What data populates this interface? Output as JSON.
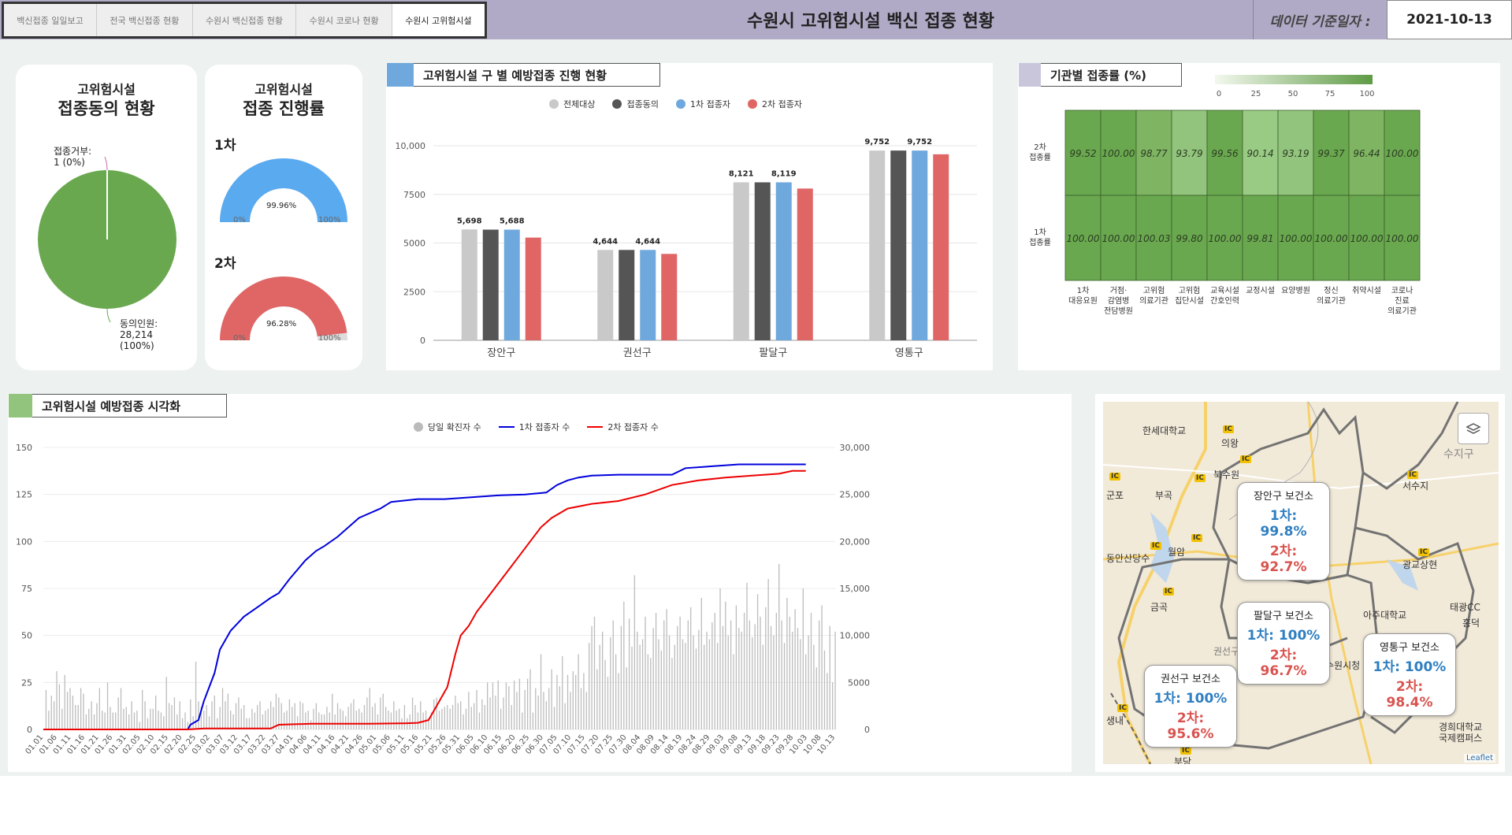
{
  "header": {
    "tabs": [
      "백신접종 일일보고",
      "전국 백신접종 현황",
      "수원시 백신접종 현황",
      "수원시 코로나 현황",
      "수원시 고위험시설"
    ],
    "title": "수원시 고위험시설 백신 접종 현황",
    "date_label": "데이터 기준일자 :",
    "date_value": "2021-10-13"
  },
  "consent_panel": {
    "title1": "고위험시설",
    "title2": "접종동의 현황",
    "refuse_label": "접종거부:",
    "refuse_value": "1 (0%)",
    "agree_label": "동의인원:",
    "agree_value": "28,214",
    "agree_pct": "(100%)",
    "colors": {
      "agree": "#69a84f",
      "refuse": "#cc66aa"
    }
  },
  "progress_panel": {
    "title1": "고위험시설",
    "title2": "접종 진행률",
    "gauges": [
      {
        "label": "1차",
        "percent_text": "99.96%",
        "fraction": 0.9996,
        "min": "0%",
        "max": "100%",
        "color": "#5aaaf0"
      },
      {
        "label": "2차",
        "percent_text": "96.28%",
        "fraction": 0.9628,
        "min": "0%",
        "max": "100%",
        "color": "#e06666"
      }
    ]
  },
  "district_panel": {
    "title": "고위험시설 구 별 예방접종 진행 현황",
    "swatch_color": "#6fa8dc"
  },
  "facility_panel": {
    "title": "기관별 접종률 (%)",
    "swatch_color": "#c9c6dc"
  },
  "timeline_panel": {
    "title": "고위험시설 예방접종 시각화",
    "swatch_color": "#93c47d"
  },
  "chart_data": [
    {
      "type": "bar",
      "categories": [
        "장안구",
        "권선구",
        "팔달구",
        "영통구"
      ],
      "series": [
        {
          "name": "전체대상",
          "color": "#c9c9c9",
          "values": [
            5698,
            4644,
            8121,
            9752
          ]
        },
        {
          "name": "접종동의",
          "color": "#555555",
          "values": [
            5688,
            4644,
            8119,
            9752
          ]
        },
        {
          "name": "1차 접종자",
          "color": "#6fa8dc",
          "values": [
            5688,
            4644,
            8119,
            9752
          ]
        },
        {
          "name": "2차 접종자",
          "color": "#e06666",
          "values": [
            5280,
            4440,
            7800,
            9560
          ]
        }
      ],
      "data_labels": [
        "5,698",
        "5,688",
        "4,644",
        "4,644",
        "8,121",
        "8,119",
        "9,752",
        "9,752"
      ],
      "yticks": [
        "0",
        "2500",
        "5000",
        "7500",
        "10,000"
      ],
      "ylim": [
        0,
        10000
      ]
    },
    {
      "type": "heatmap",
      "rows": [
        "2차 접종률",
        "1차 접종률"
      ],
      "row_labels": [
        [
          "2차",
          "접종률"
        ],
        [
          "1차",
          "접종률"
        ]
      ],
      "columns": [
        [
          "1차",
          "대응요원"
        ],
        [
          "거점·",
          "감염병",
          "전담병원"
        ],
        [
          "고위험",
          "의료기관"
        ],
        [
          "고위험",
          "집단시설"
        ],
        [
          "교육시설",
          "간호인력"
        ],
        [
          "교정시설"
        ],
        [
          "요양병원"
        ],
        [
          "정신",
          "의료기관"
        ],
        [
          "취약시설"
        ],
        [
          "코로나",
          "진료",
          "의료기관"
        ]
      ],
      "values": [
        [
          99.52,
          100.0,
          98.77,
          93.79,
          99.56,
          90.14,
          93.19,
          99.37,
          96.44,
          100.0
        ],
        [
          100.0,
          100.0,
          100.03,
          99.8,
          100.0,
          99.81,
          100.0,
          100.0,
          100.0,
          100.0
        ]
      ],
      "value_text": [
        [
          "99.52",
          "100.00",
          "98.77",
          "93.79",
          "99.56",
          "90.14",
          "93.19",
          "99.37",
          "96.44",
          "100.00"
        ],
        [
          "100.00",
          "100.00",
          "100.03",
          "99.80",
          "100.00",
          "99.81",
          "100.00",
          "100.00",
          "100.00",
          "100.00"
        ]
      ],
      "scale_ticks": [
        "0",
        "25",
        "50",
        "75",
        "100"
      ],
      "scale_colors": [
        "#f3f8ee",
        "#5f9b45"
      ]
    },
    {
      "type": "line",
      "legend": [
        {
          "name": "당일 확진자 수",
          "color": "#bbbbbb",
          "kind": "bar"
        },
        {
          "name": "1차 접종자 수",
          "color": "#0000dd",
          "kind": "line"
        },
        {
          "name": "2차 접종자 수",
          "color": "#ee0000",
          "kind": "line"
        }
      ],
      "x_labels": [
        "01.01",
        "01.06",
        "01.11",
        "01.16",
        "01.21",
        "01.26",
        "01.31",
        "02.05",
        "02.10",
        "02.15",
        "02.20",
        "02.25",
        "03.02",
        "03.07",
        "03.12",
        "03.17",
        "03.22",
        "03.27",
        "04.01",
        "04.06",
        "04.11",
        "04.16",
        "04.21",
        "04.26",
        "05.01",
        "05.06",
        "05.11",
        "05.16",
        "05.21",
        "05.26",
        "05.31",
        "06.05",
        "06.10",
        "06.15",
        "06.20",
        "06.25",
        "06.30",
        "07.05",
        "07.10",
        "07.15",
        "07.20",
        "07.25",
        "07.30",
        "08.04",
        "08.09",
        "08.14",
        "08.19",
        "08.24",
        "08.29",
        "09.03",
        "09.08",
        "09.13",
        "09.18",
        "09.23",
        "09.28",
        "10.03",
        "10.08",
        "10.13"
      ],
      "left_ticks": [
        "0",
        "25",
        "50",
        "75",
        "100",
        "125",
        "150"
      ],
      "right_ticks": [
        "0",
        "5000",
        "10,000",
        "15,000",
        "20,000",
        "25,000",
        "30,000"
      ],
      "left_max": 150,
      "right_max": 30000,
      "first_dose": [
        [
          0,
          0
        ],
        [
          54,
          0
        ],
        [
          55,
          500
        ],
        [
          58,
          1000
        ],
        [
          60,
          3000
        ],
        [
          64,
          6000
        ],
        [
          66,
          8500
        ],
        [
          70,
          10500
        ],
        [
          75,
          12000
        ],
        [
          80,
          13000
        ],
        [
          85,
          14000
        ],
        [
          88,
          14500
        ],
        [
          92,
          16000
        ],
        [
          95,
          17000
        ],
        [
          98,
          18000
        ],
        [
          102,
          19000
        ],
        [
          105,
          19500
        ],
        [
          110,
          20500
        ],
        [
          114,
          21500
        ],
        [
          118,
          22500
        ],
        [
          122,
          23000
        ],
        [
          126,
          23500
        ],
        [
          130,
          24200
        ],
        [
          140,
          24500
        ],
        [
          150,
          24500
        ],
        [
          160,
          24700
        ],
        [
          170,
          24900
        ],
        [
          180,
          25000
        ],
        [
          188,
          25200
        ],
        [
          192,
          26000
        ],
        [
          196,
          26500
        ],
        [
          200,
          26800
        ],
        [
          205,
          27000
        ],
        [
          215,
          27100
        ],
        [
          235,
          27100
        ],
        [
          240,
          27800
        ],
        [
          250,
          28000
        ],
        [
          260,
          28200
        ],
        [
          275,
          28200
        ],
        [
          285,
          28200
        ]
      ],
      "second_dose": [
        [
          0,
          0
        ],
        [
          54,
          0
        ],
        [
          60,
          100
        ],
        [
          75,
          100
        ],
        [
          85,
          100
        ],
        [
          88,
          500
        ],
        [
          100,
          600
        ],
        [
          110,
          600
        ],
        [
          122,
          600
        ],
        [
          135,
          650
        ],
        [
          140,
          700
        ],
        [
          144,
          1000
        ],
        [
          148,
          3000
        ],
        [
          151,
          4500
        ],
        [
          154,
          8000
        ],
        [
          156,
          10000
        ],
        [
          159,
          11000
        ],
        [
          162,
          12500
        ],
        [
          166,
          14000
        ],
        [
          170,
          15500
        ],
        [
          174,
          17000
        ],
        [
          178,
          18500
        ],
        [
          182,
          20000
        ],
        [
          186,
          21500
        ],
        [
          190,
          22500
        ],
        [
          196,
          23500
        ],
        [
          205,
          24000
        ],
        [
          215,
          24300
        ],
        [
          225,
          25000
        ],
        [
          235,
          26000
        ],
        [
          245,
          26500
        ],
        [
          255,
          26800
        ],
        [
          265,
          27000
        ],
        [
          275,
          27200
        ],
        [
          280,
          27500
        ],
        [
          285,
          27500
        ]
      ],
      "daily_cases": [
        0,
        21,
        10,
        18,
        15,
        31,
        24,
        11,
        29,
        20,
        22,
        18,
        13,
        13,
        22,
        19,
        8,
        11,
        15,
        8,
        14,
        22,
        10,
        9,
        25,
        12,
        9,
        9,
        17,
        22,
        11,
        12,
        8,
        15,
        9,
        10,
        4,
        21,
        15,
        6,
        11,
        11,
        18,
        10,
        9,
        7,
        28,
        14,
        13,
        17,
        8,
        15,
        6,
        9,
        4,
        16,
        7,
        36,
        15,
        12,
        10,
        13,
        7,
        15,
        18,
        6,
        12,
        22,
        15,
        19,
        10,
        8,
        14,
        17,
        11,
        13,
        6,
        6,
        11,
        9,
        13,
        15,
        8,
        10,
        11,
        15,
        12,
        19,
        17,
        14,
        9,
        10,
        16,
        12,
        14,
        7,
        15,
        14,
        9,
        10,
        5,
        11,
        14,
        9,
        8,
        8,
        12,
        9,
        19,
        8,
        14,
        11,
        10,
        7,
        12,
        14,
        16,
        10,
        11,
        9,
        13,
        17,
        22,
        12,
        14,
        8,
        17,
        19,
        12,
        10,
        9,
        15,
        10,
        11,
        6,
        13,
        6,
        8,
        17,
        13,
        9,
        15,
        9,
        10,
        6,
        9,
        16,
        17,
        10,
        11,
        12,
        13,
        11,
        13,
        18,
        14,
        15,
        8,
        11,
        20,
        12,
        14,
        21,
        9,
        16,
        13,
        25,
        17,
        25,
        18,
        26,
        11,
        17,
        25,
        23,
        13,
        26,
        20,
        27,
        9,
        21,
        27,
        32,
        9,
        22,
        18,
        40,
        20,
        15,
        22,
        32,
        12,
        29,
        23,
        39,
        14,
        29,
        20,
        31,
        29,
        40,
        22,
        30,
        20,
        46,
        55,
        60,
        32,
        45,
        52,
        37,
        28,
        49,
        58,
        40,
        30,
        55,
        68,
        33,
        59,
        44,
        82,
        52,
        45,
        48,
        60,
        40,
        38,
        54,
        62,
        48,
        42,
        58,
        64,
        50,
        38,
        45,
        55,
        60,
        48,
        46,
        58,
        65,
        50,
        43,
        53,
        70,
        45,
        52,
        48,
        57,
        62,
        46,
        75,
        55,
        68,
        50,
        58,
        40,
        66,
        54,
        52,
        62,
        78,
        58,
        49,
        56,
        72,
        60,
        45,
        65,
        80,
        55,
        50,
        62,
        88,
        58,
        46,
        70,
        60,
        52,
        64,
        54,
        48,
        75,
        40,
        50,
        62,
        45,
        33,
        58,
        66,
        42,
        30,
        55,
        25,
        52
      ]
    }
  ],
  "map": {
    "labels": [
      "한세대학교",
      "의왕",
      "북수원",
      "부곡",
      "군포",
      "동안산당수",
      "월암",
      "금곡",
      "권선구",
      "생내",
      "부당",
      "수지구",
      "서수지",
      "광교상현",
      "아주대학교",
      "태광CC",
      "홍덕",
      "수원시청",
      "경희대학교",
      "국제캠퍼스"
    ],
    "popups": [
      {
        "name": "장안구 보건소",
        "first": "1차: 99.8%",
        "second": "2차: 92.7%"
      },
      {
        "name": "팔달구 보건소",
        "first": "1차: 100%",
        "second": "2차: 96.7%"
      },
      {
        "name": "영통구 보건소",
        "first": "1차: 100%",
        "second": "2차: 98.4%"
      },
      {
        "name": "권선구 보건소",
        "first": "1차: 100%",
        "second": "2차: 95.6%"
      }
    ],
    "attribution": "Leaflet",
    "layers_icon": "layers-icon"
  }
}
